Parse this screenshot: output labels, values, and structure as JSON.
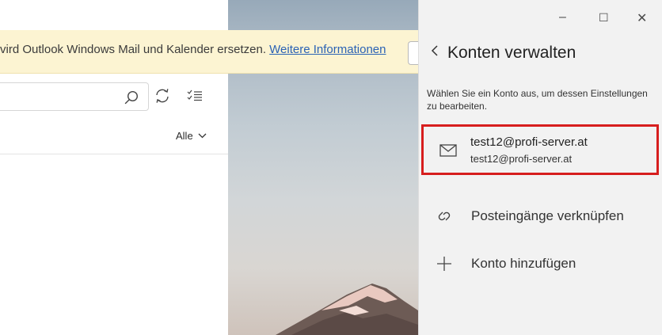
{
  "banner": {
    "text": "vird Outlook Windows Mail und Kalender ersetzen.",
    "link": "Weitere Informationen"
  },
  "toolbar": {
    "filter_label": "Alle"
  },
  "window_controls": {
    "minimize": "–",
    "maximize": "☐",
    "close": "✕"
  },
  "panel": {
    "title": "Konten verwalten",
    "description": "Wählen Sie ein Konto aus, um dessen Einstellungen zu bearbeiten.",
    "account": {
      "name": "test12@profi-server.at",
      "email": "test12@profi-server.at"
    },
    "actions": [
      {
        "label": "Posteingänge verknüpfen",
        "icon": "link-icon"
      },
      {
        "label": "Konto hinzufügen",
        "icon": "plus-icon"
      }
    ]
  },
  "colors": {
    "banner_bg": "#fcf4d2",
    "link": "#2a62b5",
    "panel_bg": "#f2f2f2",
    "highlight": "#d71e1e"
  }
}
